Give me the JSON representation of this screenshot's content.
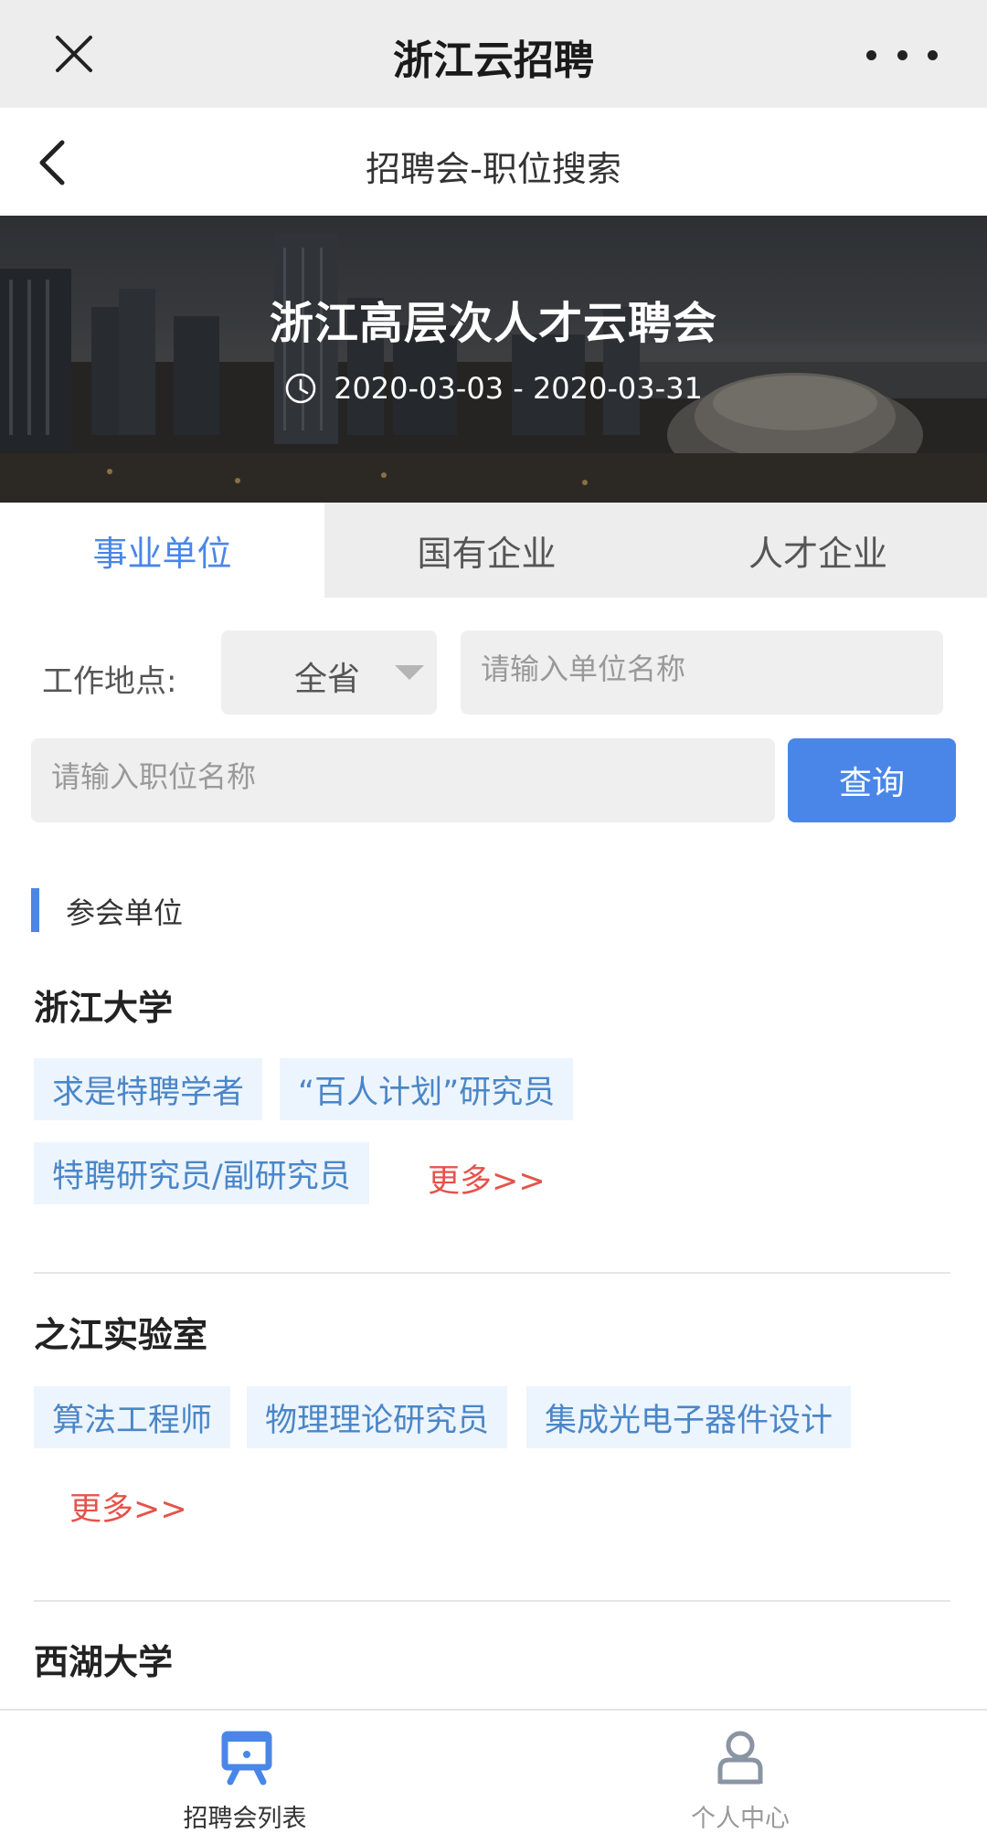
{
  "topbar": {
    "title": "浙江云招聘",
    "close_icon": "close-icon",
    "more_icon": "more-dots-icon"
  },
  "subheader": {
    "title": "招聘会-职位搜索",
    "back_icon": "chevron-left-icon"
  },
  "banner": {
    "title": "浙江高层次人才云聘会",
    "date_range": "2020-03-03 - 2020-03-31",
    "clock_icon": "clock-icon"
  },
  "tabs": [
    {
      "label": "事业单位",
      "active": true
    },
    {
      "label": "国有企业",
      "active": false
    },
    {
      "label": "人才企业",
      "active": false
    }
  ],
  "filters": {
    "location_label": "工作地点:",
    "location_value": "全省",
    "unit_placeholder": "请输入单位名称",
    "job_placeholder": "请输入职位名称",
    "search_label": "查询"
  },
  "section": {
    "title": "参会单位"
  },
  "orgs": [
    {
      "name": "浙江大学",
      "positions": [
        "求是特聘学者",
        "“百人计划”研究员",
        "特聘研究员/副研究员"
      ],
      "more": "更多>>"
    },
    {
      "name": "之江实验室",
      "positions": [
        "算法工程师",
        "物理理论研究员",
        "集成光电子器件设计"
      ],
      "more": "更多>>"
    },
    {
      "name": "西湖大学"
    }
  ],
  "bottom_nav": [
    {
      "label": "招聘会列表",
      "icon": "job-fair-icon",
      "active": true
    },
    {
      "label": "个人中心",
      "icon": "person-icon",
      "active": false
    }
  ],
  "colors": {
    "accent": "#4a86e8",
    "more_link": "#e5534b",
    "tag_bg": "#ecf4fd"
  }
}
